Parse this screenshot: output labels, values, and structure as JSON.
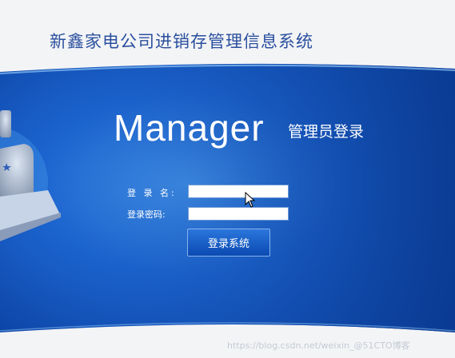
{
  "header": {
    "title": "新鑫家电公司进销存管理信息系统"
  },
  "banner": {
    "brand_word": "Manager",
    "brand_sub": "管理员登录"
  },
  "login_form": {
    "username_label": "登 录 名:",
    "username_value": "",
    "password_label": "登录密码:",
    "password_value": "",
    "submit_label": "登录系统"
  },
  "watermark": {
    "text": "https://blog.csdn.net/weixin_@51CTO博客"
  },
  "colors": {
    "title_text": "#2a4f9e",
    "banner_blue": "#0a46b0",
    "banner_light": "#5aa6f0",
    "background": "#f3f4f6"
  },
  "icons": {
    "user_graphic": "admin-user-icon",
    "pointer": "mouse-pointer-icon"
  }
}
